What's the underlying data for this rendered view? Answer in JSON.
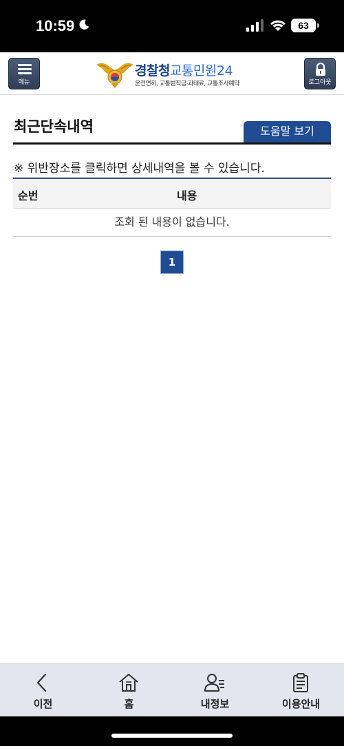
{
  "status_bar": {
    "time": "10:59",
    "battery": "63"
  },
  "header": {
    "menu_label": "메뉴",
    "logout_label": "로그아웃",
    "logo_title_1": "경찰청",
    "logo_title_2": "교통민원24",
    "logo_subtitle": "운전면허, 교통범칙금·과태료, 교통조사예약"
  },
  "page": {
    "title": "최근단속내역",
    "help_button": "도움말 보기",
    "notice": "※ 위반장소를 클릭하면 상세내역을 볼 수 있습니다.",
    "table": {
      "col_no": "순번",
      "col_content": "내용",
      "empty_message": "조회 된 내용이 없습니다."
    },
    "pagination": {
      "current_page": "1"
    }
  },
  "bottom_nav": {
    "items": [
      {
        "label": "이전",
        "icon": "chevron-left-icon"
      },
      {
        "label": "홈",
        "icon": "home-icon"
      },
      {
        "label": "내정보",
        "icon": "user-info-icon"
      },
      {
        "label": "이용안내",
        "icon": "clipboard-icon"
      }
    ]
  },
  "colors": {
    "brand_navy": "#1f4c93",
    "header_button": "#3b4a66",
    "nav_bg": "#e4e6ef"
  }
}
